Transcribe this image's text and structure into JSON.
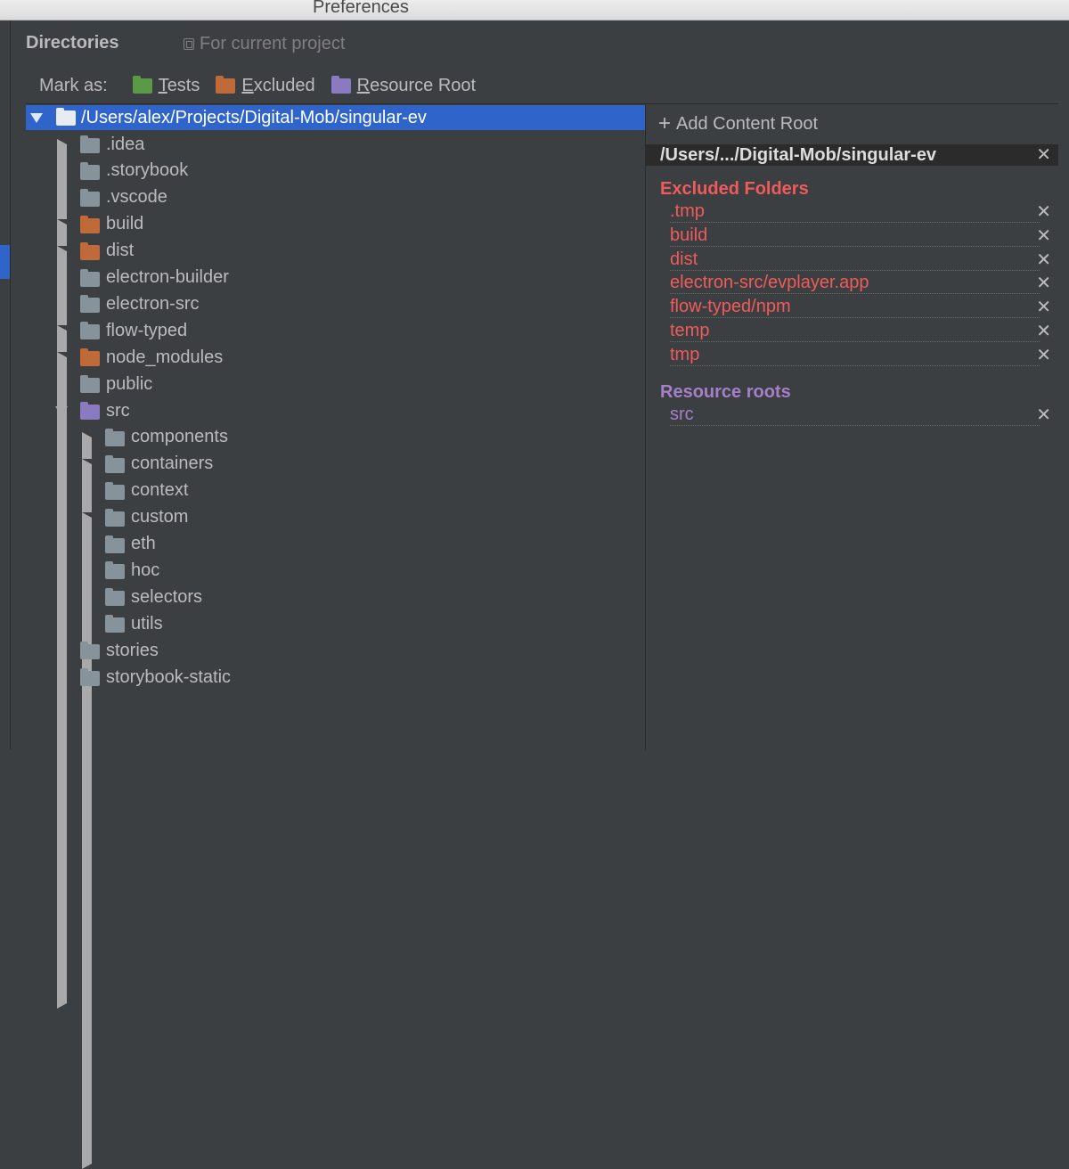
{
  "window": {
    "title": "Preferences"
  },
  "header": {
    "title": "Directories",
    "scope_label": "For current project"
  },
  "mark_as": {
    "label": "Mark as:",
    "buttons": [
      {
        "label": "Tests",
        "color": "#5a9a46"
      },
      {
        "label": "Excluded",
        "color": "#c06a3a"
      },
      {
        "label": "Resource Root",
        "color": "#8a7ac0"
      }
    ]
  },
  "tree": {
    "root": "/Users/alex/Projects/Digital-Mob/singular-ev",
    "items": [
      {
        "label": ".idea",
        "level": 1,
        "arrow": "right",
        "color": "gray"
      },
      {
        "label": ".storybook",
        "level": 1,
        "arrow": "none",
        "color": "gray"
      },
      {
        "label": ".vscode",
        "level": 1,
        "arrow": "none",
        "color": "gray"
      },
      {
        "label": "build",
        "level": 1,
        "arrow": "right",
        "color": "orange"
      },
      {
        "label": "dist",
        "level": 1,
        "arrow": "right",
        "color": "orange"
      },
      {
        "label": "electron-builder",
        "level": 1,
        "arrow": "none",
        "color": "gray"
      },
      {
        "label": "electron-src",
        "level": 1,
        "arrow": "none",
        "color": "gray"
      },
      {
        "label": "flow-typed",
        "level": 1,
        "arrow": "right",
        "color": "gray"
      },
      {
        "label": "node_modules",
        "level": 1,
        "arrow": "right",
        "color": "orange"
      },
      {
        "label": "public",
        "level": 1,
        "arrow": "none",
        "color": "gray"
      },
      {
        "label": "src",
        "level": 1,
        "arrow": "down",
        "color": "purple"
      },
      {
        "label": "components",
        "level": 2,
        "arrow": "right",
        "color": "gray"
      },
      {
        "label": "containers",
        "level": 2,
        "arrow": "right",
        "color": "gray"
      },
      {
        "label": "context",
        "level": 2,
        "arrow": "none",
        "color": "gray"
      },
      {
        "label": "custom",
        "level": 2,
        "arrow": "right",
        "color": "gray"
      },
      {
        "label": "eth",
        "level": 2,
        "arrow": "none",
        "color": "gray"
      },
      {
        "label": "hoc",
        "level": 2,
        "arrow": "none",
        "color": "gray"
      },
      {
        "label": "selectors",
        "level": 2,
        "arrow": "none",
        "color": "gray"
      },
      {
        "label": "utils",
        "level": 2,
        "arrow": "none",
        "color": "gray"
      },
      {
        "label": "stories",
        "level": 1,
        "arrow": "none",
        "color": "gray"
      },
      {
        "label": "storybook-static",
        "level": 1,
        "arrow": "none",
        "color": "gray"
      }
    ]
  },
  "content_root": {
    "add_label": "Add Content Root",
    "path": "/Users/.../Digital-Mob/singular-ev",
    "excluded_title": "Excluded Folders",
    "excluded": [
      ".tmp",
      "build",
      "dist",
      "electron-src/evplayer.app",
      "flow-typed/npm",
      "temp",
      "tmp"
    ],
    "resource_title": "Resource roots",
    "resources": [
      "src"
    ]
  },
  "colors": {
    "accent": "#2f65ca",
    "excluded_text": "#ef5b5b",
    "resource_text": "#a57fc8",
    "background": "#3c3f41"
  }
}
